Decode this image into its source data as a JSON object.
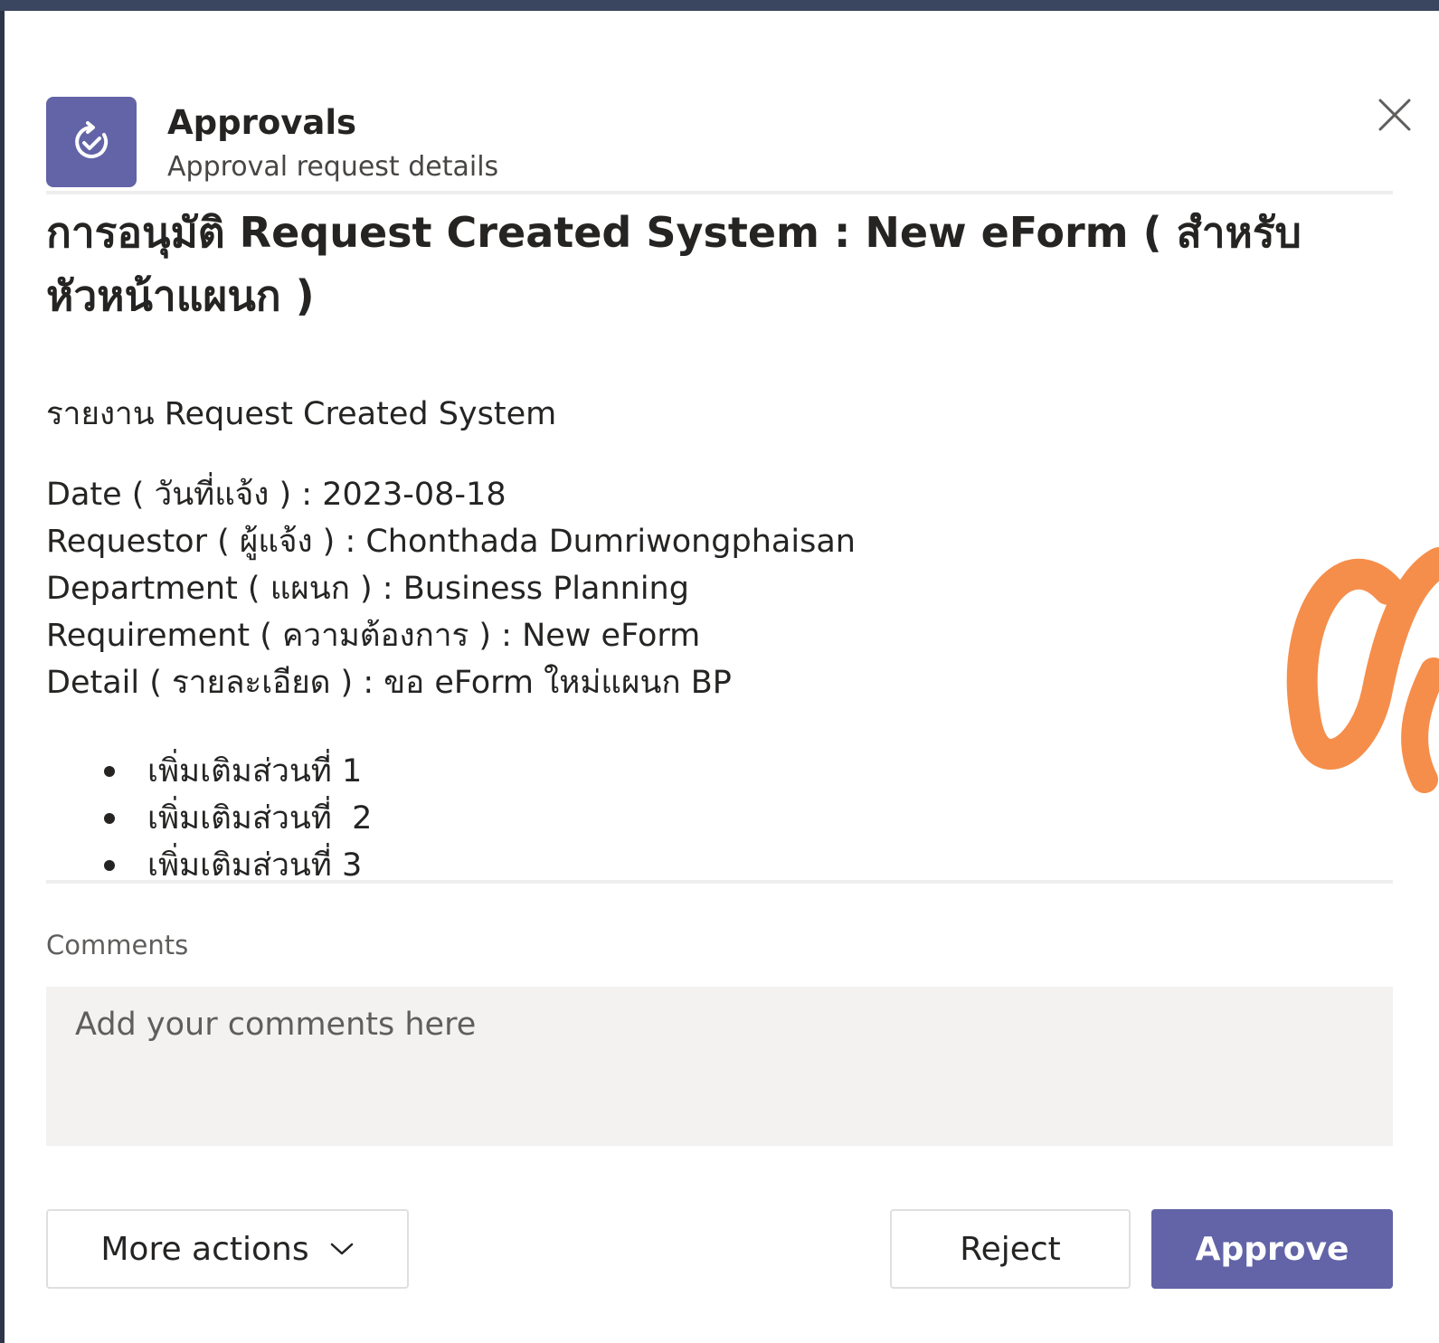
{
  "header": {
    "app_name": "Approvals",
    "subtitle": "Approval request details"
  },
  "request": {
    "title": "การอนุมัติ Request Created System : New eForm ( สำหรับหัวหน้าแผนก )",
    "report_line": "รายงาน Request Created System",
    "fields": [
      "Date ( วันที่แจ้ง ) : 2023-08-18",
      "Requestor ( ผู้แจ้ง ) : Chonthada Dumriwongphaisan",
      "Department ( แผนก ) : Business Planning",
      "Requirement ( ความต้องการ ) : New eForm",
      "Detail ( รายละเอียด ) : ขอ eForm ใหม่แผนก BP"
    ],
    "bullets": [
      "เพิ่มเติมส่วนที่ 1",
      "เพิ่มเติมส่วนที่  2",
      "เพิ่มเติมส่วนที่ 3"
    ]
  },
  "comments": {
    "label": "Comments",
    "placeholder": "Add your comments here",
    "value": ""
  },
  "actions": {
    "more_label": "More actions",
    "reject_label": "Reject",
    "approve_label": "Approve"
  },
  "icons": {
    "app": "approvals-icon",
    "close": "close-icon",
    "chevron": "chevron-down-icon"
  },
  "colors": {
    "accent": "#6264a7",
    "watermark": "#f58e4b",
    "backdrop": "#2e3548"
  }
}
